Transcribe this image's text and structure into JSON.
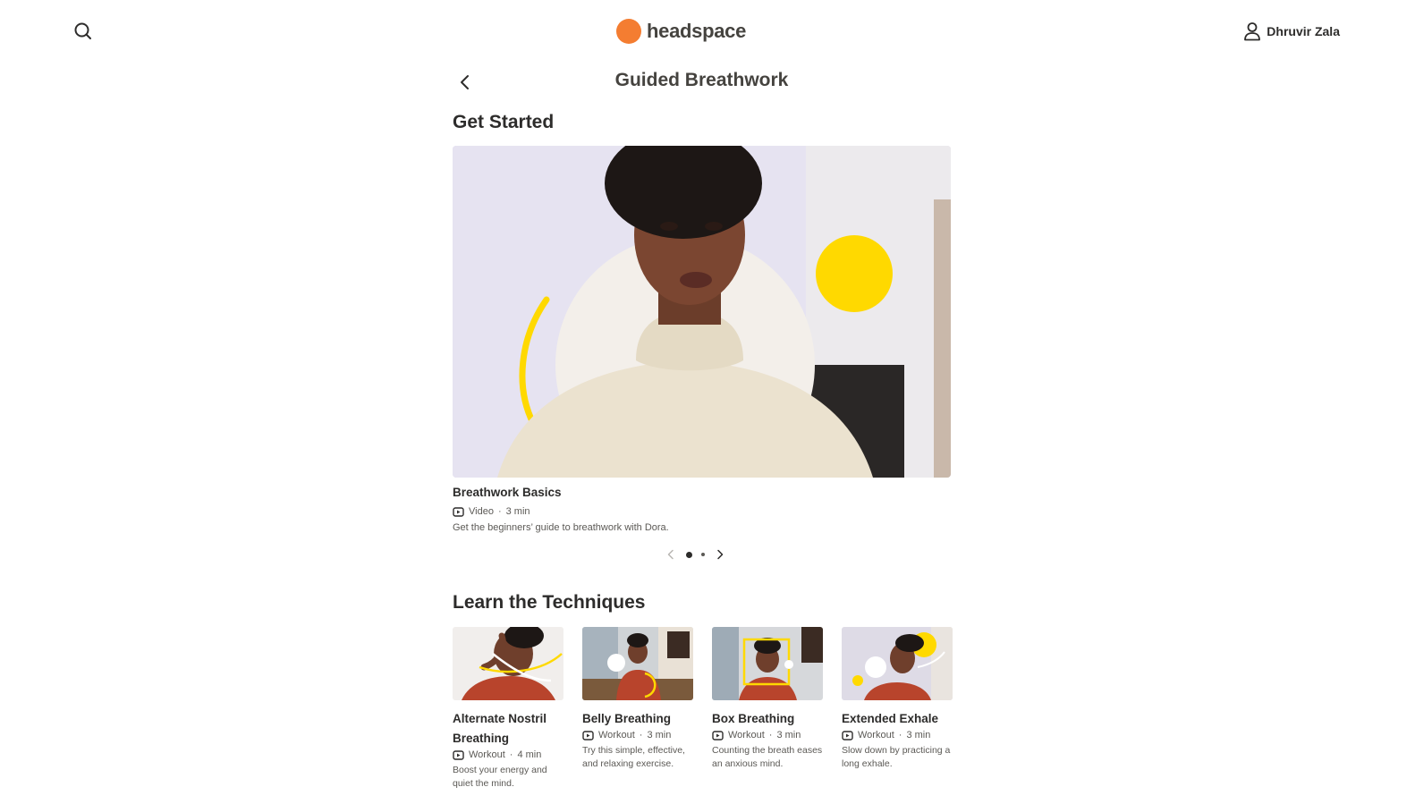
{
  "header": {
    "logo_text": "headspace",
    "user_name": "Dhruvir Zala"
  },
  "page": {
    "title": "Guided Breathwork"
  },
  "get_started": {
    "heading": "Get Started",
    "featured": {
      "title": "Breathwork Basics",
      "type": "Video",
      "duration": "3 min",
      "description": "Get the beginners’ guide to breathwork with Dora."
    },
    "pager": {
      "pages": 2,
      "active": 1
    }
  },
  "techniques": {
    "heading": "Learn the Techniques",
    "cards": [
      {
        "title": "Alternate Nostril Breathing",
        "type": "Workout",
        "duration": "4 min",
        "description": "Boost your energy and quiet the mind."
      },
      {
        "title": "Belly Breathing",
        "type": "Workout",
        "duration": "3 min",
        "description": "Try this simple, effective, and relaxing exercise."
      },
      {
        "title": "Box Breathing",
        "type": "Workout",
        "duration": "3 min",
        "description": "Counting the breath eases an anxious mind."
      },
      {
        "title": "Extended Exhale",
        "type": "Workout",
        "duration": "3 min",
        "description": "Slow down by practicing a long exhale."
      }
    ]
  },
  "colors": {
    "brand_orange": "#f47d31",
    "accent_yellow": "#ffd900",
    "text_dark": "#2d2c2b"
  },
  "icons": [
    "search-icon",
    "user-icon",
    "chevron-left-icon",
    "video-icon",
    "chevron-right-icon"
  ]
}
